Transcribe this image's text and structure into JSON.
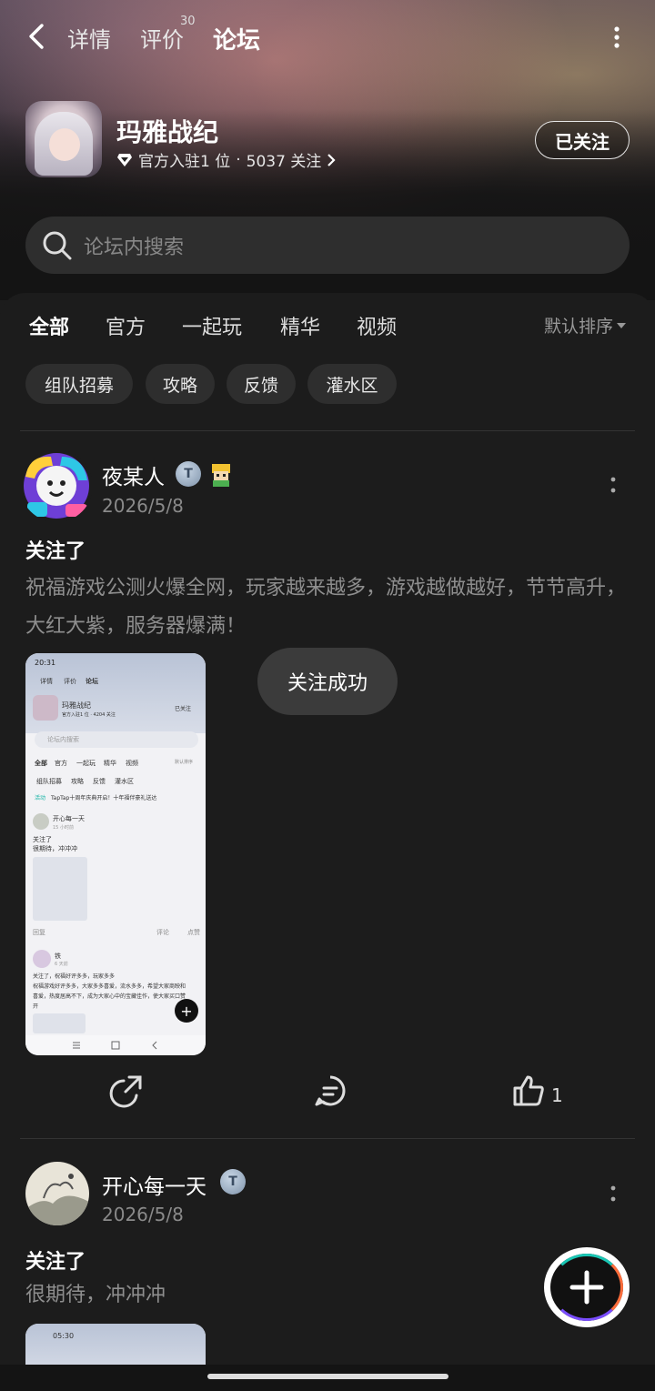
{
  "top_nav": {
    "tabs": [
      {
        "label": "详情"
      },
      {
        "label": "评价",
        "badge": "30"
      },
      {
        "label": "论坛"
      }
    ]
  },
  "game": {
    "title": "玛雅战纪",
    "meta_official": "官方入驻1 位",
    "meta_dot": "·",
    "meta_followers": "5037 关注",
    "follow_button": "已关注"
  },
  "search": {
    "placeholder": "论坛内搜索"
  },
  "category_tabs": [
    "全部",
    "官方",
    "一起玩",
    "精华",
    "视频"
  ],
  "sort_label": "默认排序",
  "chips": [
    "组队招募",
    "攻略",
    "反馈",
    "灌水区"
  ],
  "posts": [
    {
      "author": "夜某人",
      "date": "2026/5/8",
      "title": "关注了",
      "body": "祝福游戏公测火爆全网，玩家越来越多，游戏越做越好，节节高升，大红大紫，服务器爆满！",
      "likes": "1",
      "screenshot": {
        "time": "20:31",
        "tabs": [
          "详情",
          "评价",
          "论坛"
        ],
        "game_title": "玛雅战纪",
        "game_meta": "官方入驻1 位 · 4204 关注",
        "follow": "已关注",
        "search": "论坛内搜索",
        "cats": [
          "全部",
          "官方",
          "一起玩",
          "精华",
          "视频",
          "默认排序"
        ],
        "chips": [
          "组队招募",
          "攻略",
          "反馈",
          "灌水区"
        ],
        "notice_tag": "活动",
        "notice": "TapTap十周年庆典开启！十年福伴豪礼送达",
        "p1_author": "开心每一天",
        "p1_time": "15 小时前",
        "p1_title": "关注了",
        "p1_body": "很期待，冲冲冲",
        "p1_reply": "回复",
        "p1_comment": "评论",
        "p1_like": "点赞",
        "p2_author": "铁",
        "p2_time": "6 天前",
        "p2_line1": "关注了，祝福好评多多，玩家多多",
        "p2_line2": "祝福游戏好评多多，大家多多喜爱，流水多多，希望大家商映和",
        "p2_line3": "喜爱，热度居高不下，成为大家心中的宝藏佳作，使大家买口赞",
        "p2_line4": "开"
      }
    },
    {
      "author": "开心每一天",
      "date": "2026/5/8",
      "title": "关注了",
      "body": "很期待，冲冲冲",
      "screenshot": {
        "time": "05:30"
      }
    }
  ],
  "toast": "关注成功",
  "colors": {
    "accent": "#16b3a4",
    "background": "#1c1c1c",
    "chip": "#2e2e2e"
  }
}
